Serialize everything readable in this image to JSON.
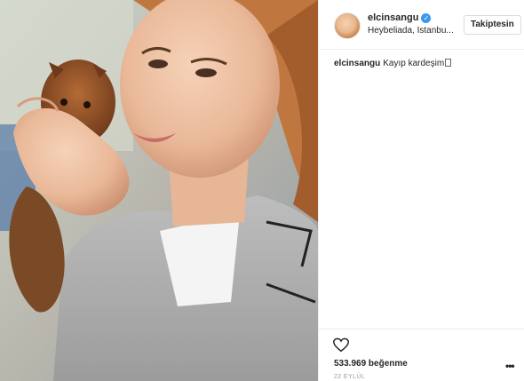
{
  "post": {
    "username": "elcinsangu",
    "location": "Heybeliada, Istanbu...",
    "follow_label": "Takiptesin",
    "caption_user": "elcinsangu",
    "caption_text": "Kayıp kardeşim",
    "likes": "533.969 beğenme",
    "date": "22 EYLÜL"
  },
  "icons": {
    "verified": "verified-badge-icon",
    "like": "heart-outline-icon",
    "more": "ellipsis-icon",
    "emoji": "unrendered-emoji-glyph"
  },
  "colors": {
    "verified": "#3897f0",
    "border": "#efefef",
    "text": "#262626",
    "muted": "#999999"
  }
}
